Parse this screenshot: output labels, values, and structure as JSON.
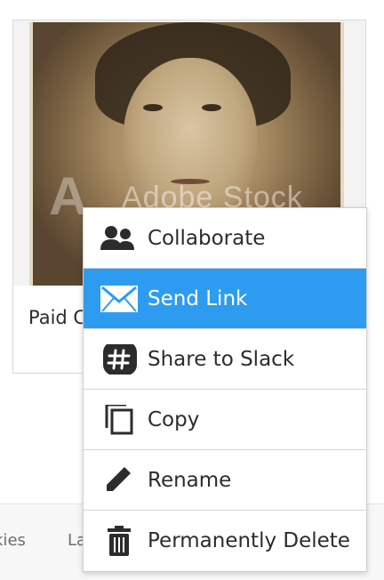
{
  "asset_card": {
    "label": "Paid C",
    "watermark_text": "Adobe Stock"
  },
  "footer": {
    "cookies_link": "okies",
    "language_link": "La"
  },
  "context_menu": {
    "active_color": "#2d9cf0",
    "items": [
      {
        "label": "Collaborate",
        "icon": "collaborate-icon"
      },
      {
        "label": "Send Link",
        "icon": "mail-icon",
        "active": true
      },
      {
        "label": "Share to Slack",
        "icon": "slack-icon"
      },
      {
        "label": "Copy",
        "icon": "copy-icon"
      },
      {
        "label": "Rename",
        "icon": "pencil-icon"
      },
      {
        "label": "Permanently Delete",
        "icon": "trash-icon"
      }
    ]
  }
}
